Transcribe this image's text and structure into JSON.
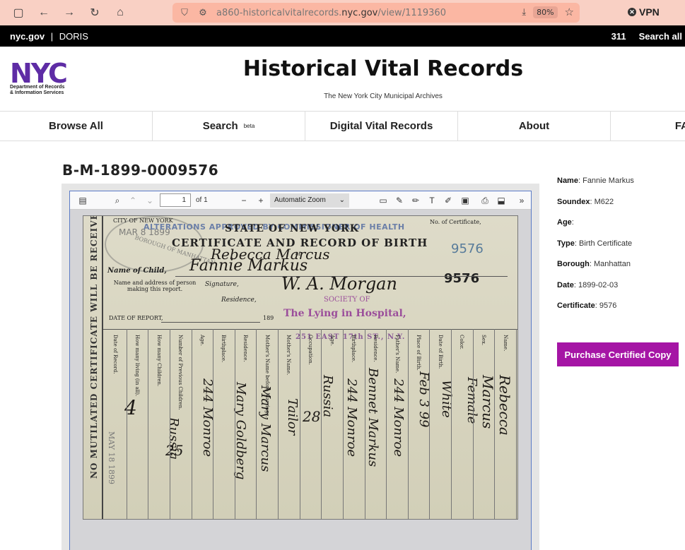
{
  "browser": {
    "url_prefix": "a860-historicalvitalrecords.",
    "url_domain": "nyc.gov",
    "url_path": "/view/1119360",
    "zoom": "80%",
    "vpn_label": "VPN"
  },
  "gov_bar": {
    "brand": "nyc.gov",
    "separator": "|",
    "agency": "DORIS",
    "link_311": "311",
    "search_all": "Search all"
  },
  "header": {
    "logo_text": "NYC",
    "logo_dept_line1": "Department of Records",
    "logo_dept_line2": "& Information Services",
    "title": "Historical Vital Records",
    "subtitle": "The New York City Municipal Archives"
  },
  "nav": {
    "browse_all": "Browse All",
    "search": "Search",
    "search_badge": "beta",
    "digital_vital_records": "Digital Vital Records",
    "about": "About",
    "cut_item": "FA"
  },
  "record": {
    "id": "B-M-1899-0009576"
  },
  "viewer": {
    "page_number": "1",
    "page_total": "of 1",
    "zoom_option": "Automatic Zoom"
  },
  "certificate": {
    "stamp_alterations": "ALTERATIONS APPROVED BY COMMISSIONER OF HEALTH",
    "state": "STATE OF NEW YORK",
    "title": "CERTIFICATE AND RECORD OF BIRTH",
    "city_stamp": "CITY OF NEW YORK",
    "stamp_date": "MAR 8 1899",
    "borough_stamp": "BOROUGH OF MANHATTAN",
    "no_of_certificate": "No. of Certificate,",
    "number_blue": "9576",
    "number_black": "9576",
    "of_label": "of",
    "name_of_child_label": "Name of Child,",
    "name_of_child_hand": "Fannie Markus",
    "first_line_hand": "Rebecca Marcus",
    "reporter_label": "Name and address of person making this report.",
    "signature_label": "Signature,",
    "signature_hand": "W. A. Morgan",
    "residence_label": "Residence,",
    "date_of_report_label": "DATE OF REPORT,",
    "year_suffix": "189",
    "society": "SOCIETY OF",
    "hospital": "The Lying in Hospital,",
    "address": "251 EAST 17th ST., N.Y.",
    "vertical_notice": "NO MUTILATED CERTIFICATE WILL BE RECEIVED.",
    "received_stamp": "MAY 18 1899",
    "columns": [
      "Date of Record.",
      "How many living (in all).",
      "How many Children.",
      "Number of Previous Children.",
      "Age.",
      "Birthplace.",
      "Residence.",
      "Mother's Name before Marriage.",
      "Mother's Name.",
      "Occupation.",
      "Age.",
      "Birthplace.",
      "Residence.",
      "Father's Name.",
      "Place of Birth.",
      "Date of Birth.",
      "Color.",
      "Sex.",
      "Name."
    ],
    "hand_values": {
      "count": "4",
      "age_mother": "25",
      "birthplace_mother": "Russia",
      "residence_mother": "244 Monroe",
      "mother_maiden": "Mary Goldberg",
      "mother_name": "Mary Marcus",
      "occupation": "Tailor",
      "age_father": "28",
      "birthplace_father": "Russia",
      "residence_father": "244 Monroe",
      "father_name": "Bennet Markus",
      "place_of_birth": "244 Monroe",
      "date_of_birth": "Feb 3 99",
      "color": "White",
      "sex": "Female",
      "name": "Rebecca Marcus"
    }
  },
  "details": {
    "name_label": "Name",
    "name_value": "Fannie Markus",
    "soundex_label": "Soundex",
    "soundex_value": "M622",
    "age_label": "Age",
    "age_value": "",
    "type_label": "Type",
    "type_value": "Birth Certificate",
    "borough_label": "Borough",
    "borough_value": "Manhattan",
    "date_label": "Date",
    "date_value": "1899-02-03",
    "certificate_label": "Certificate",
    "certificate_value": "9576"
  },
  "actions": {
    "purchase": "Purchase Certified Copy"
  }
}
